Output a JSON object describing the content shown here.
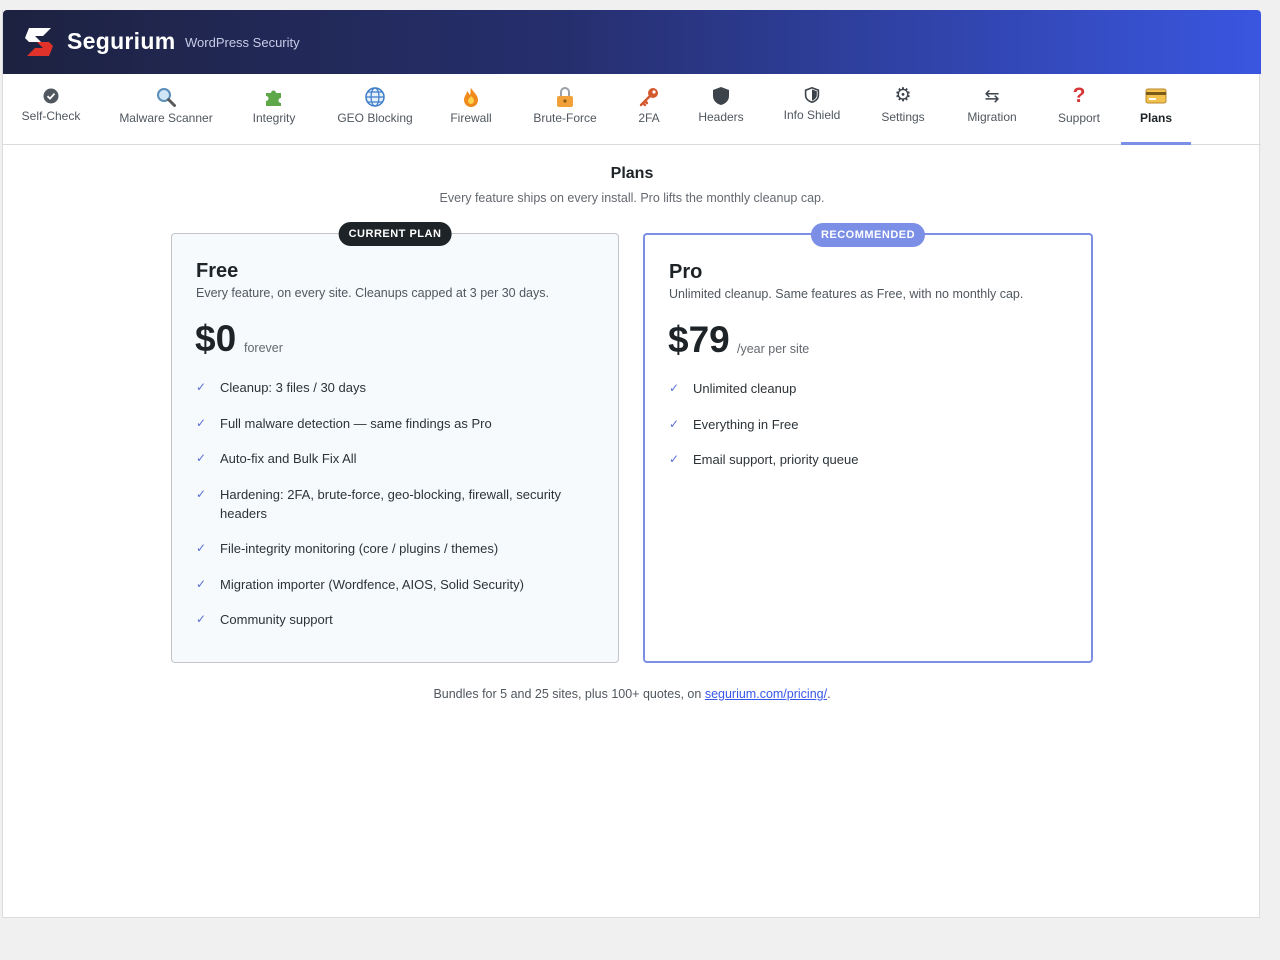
{
  "header": {
    "brand": "Segurium",
    "tagline": "WordPress Security"
  },
  "nav": {
    "tabs": [
      {
        "label": "Self-Check",
        "icon": "check-circle-icon"
      },
      {
        "label": "Malware Scanner",
        "icon": "magnifier-icon"
      },
      {
        "label": "Integrity",
        "icon": "puzzle-icon"
      },
      {
        "label": "GEO Blocking",
        "icon": "globe-icon"
      },
      {
        "label": "Firewall",
        "icon": "fire-icon"
      },
      {
        "label": "Brute-Force",
        "icon": "lock-icon"
      },
      {
        "label": "2FA",
        "icon": "key-icon"
      },
      {
        "label": "Headers",
        "icon": "shield-icon"
      },
      {
        "label": "Info Shield",
        "icon": "half-shield-icon"
      },
      {
        "label": "Settings",
        "icon": "gear-icon"
      },
      {
        "label": "Migration",
        "icon": "swap-arrows-icon"
      },
      {
        "label": "Support",
        "icon": "question-icon"
      },
      {
        "label": "Plans",
        "icon": "credit-card-icon",
        "active": true
      }
    ]
  },
  "main": {
    "title": "Plans",
    "subtitle": "Every feature ships on every install. Pro lifts the monthly cleanup cap.",
    "plans": [
      {
        "badge": "CURRENT PLAN",
        "name": "Free",
        "description": "Every feature, on every site. Cleanups capped at 3 per 30 days.",
        "price": "$0",
        "period": "forever",
        "features": [
          "Cleanup: 3 files / 30 days",
          "Full malware detection — same findings as Pro",
          "Auto-fix and Bulk Fix All",
          "Hardening: 2FA, brute-force, geo-blocking, firewall, security headers",
          "File-integrity monitoring (core / plugins / themes)",
          "Migration importer (Wordfence, AIOS, Solid Security)",
          "Community support"
        ]
      },
      {
        "badge": "RECOMMENDED",
        "name": "Pro",
        "description": "Unlimited cleanup. Same features as Free, with no monthly cap.",
        "price": "$79",
        "period": "/year per site",
        "features": [
          "Unlimited cleanup",
          "Everything in Free",
          "Email support, priority queue"
        ]
      }
    ],
    "footer_prefix": "Bundles for 5 and 25 sites, plus 100+ quotes, on ",
    "footer_link": "segurium.com/pricing/",
    "footer_suffix": "."
  },
  "colors": {
    "accent": "#7b8fe6",
    "link": "#3858e9",
    "header_start": "#1d2240",
    "header_end": "#3a56e0"
  }
}
